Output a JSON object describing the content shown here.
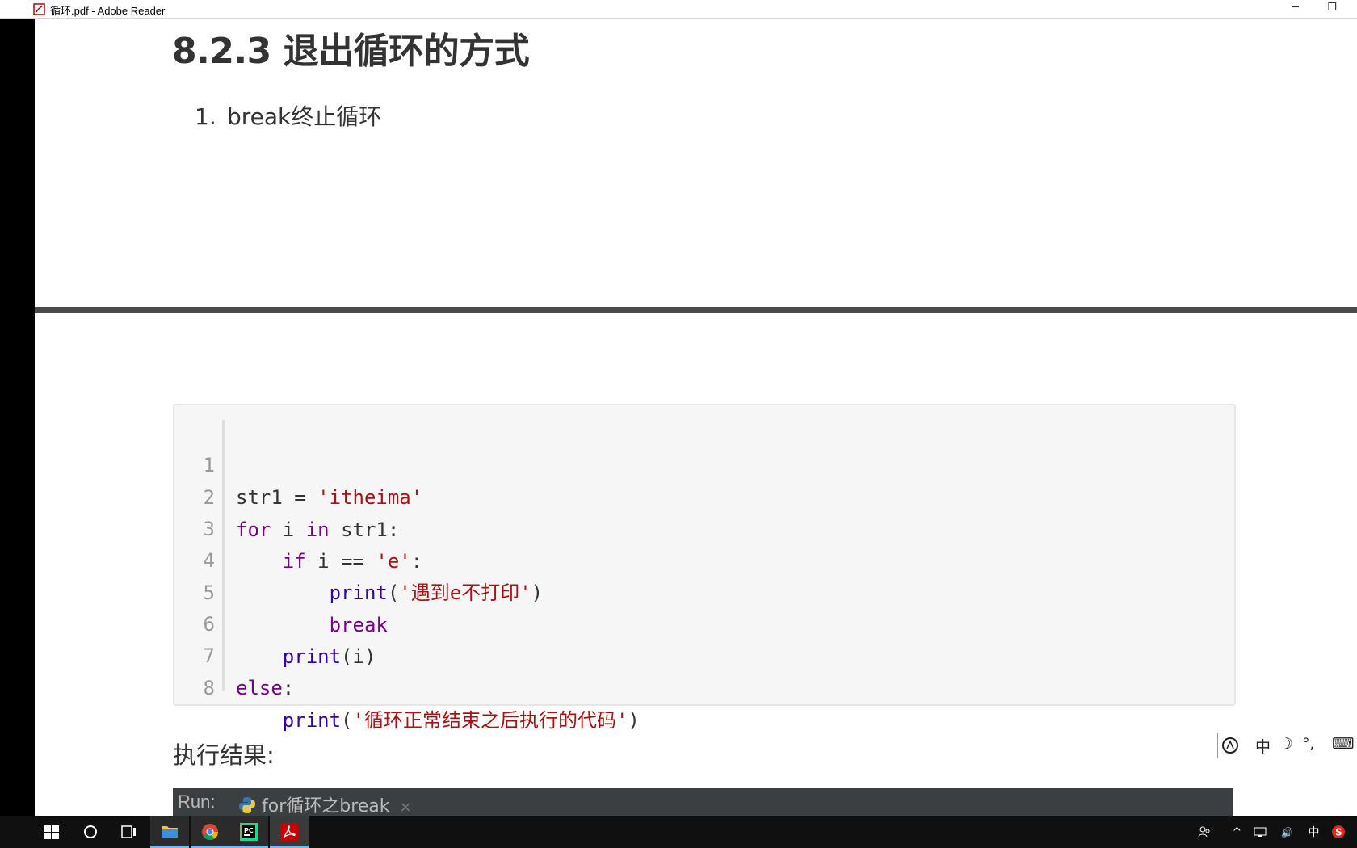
{
  "window": {
    "title": "循环.pdf - Adobe Reader",
    "minimize_glyph": "─",
    "restore_glyph": "❐"
  },
  "document": {
    "section_title": "8.2.3 退出循环的方式",
    "list_number": "1.",
    "list_text": "break终止循环",
    "code_lines": [
      {
        "n": "1"
      },
      {
        "n": "2"
      },
      {
        "n": "3"
      },
      {
        "n": "4"
      },
      {
        "n": "5"
      },
      {
        "n": "6"
      },
      {
        "n": "7"
      },
      {
        "n": "8"
      }
    ],
    "code": {
      "l1_a": "str1 = ",
      "l1_b": "'itheima'",
      "l2_a": "for",
      "l2_b": " i ",
      "l2_c": "in",
      "l2_d": " str1:",
      "l3_a": "    ",
      "l3_b": "if",
      "l3_c": " i == ",
      "l3_d": "'e'",
      "l3_e": ":",
      "l4_a": "        ",
      "l4_b": "print",
      "l4_c": "(",
      "l4_d": "'遇到e不打印'",
      "l4_e": ")",
      "l5_a": "        ",
      "l5_b": "break",
      "l6_a": "    ",
      "l6_b": "print",
      "l6_c": "(i)",
      "l7_a": "else",
      "l7_b": ":",
      "l8_a": "    ",
      "l8_b": "print",
      "l8_c": "(",
      "l8_d": "'循环正常结束之后执行的代码'",
      "l8_e": ")"
    },
    "result_label": "执行结果:",
    "run_label": "Run:",
    "run_tab": "for循环之break",
    "run_tab_close": "×"
  },
  "ime": {
    "mode": "中",
    "moon": "☽",
    "punct": "°,",
    "keyboard": "⌨"
  },
  "taskbar": {
    "tray_lang": "中",
    "tray_speaker": "🔊"
  },
  "colors": {
    "keyword": "#770088",
    "string": "#aa1111",
    "function": "#3300aa",
    "run_panel": "#3c3f41"
  }
}
